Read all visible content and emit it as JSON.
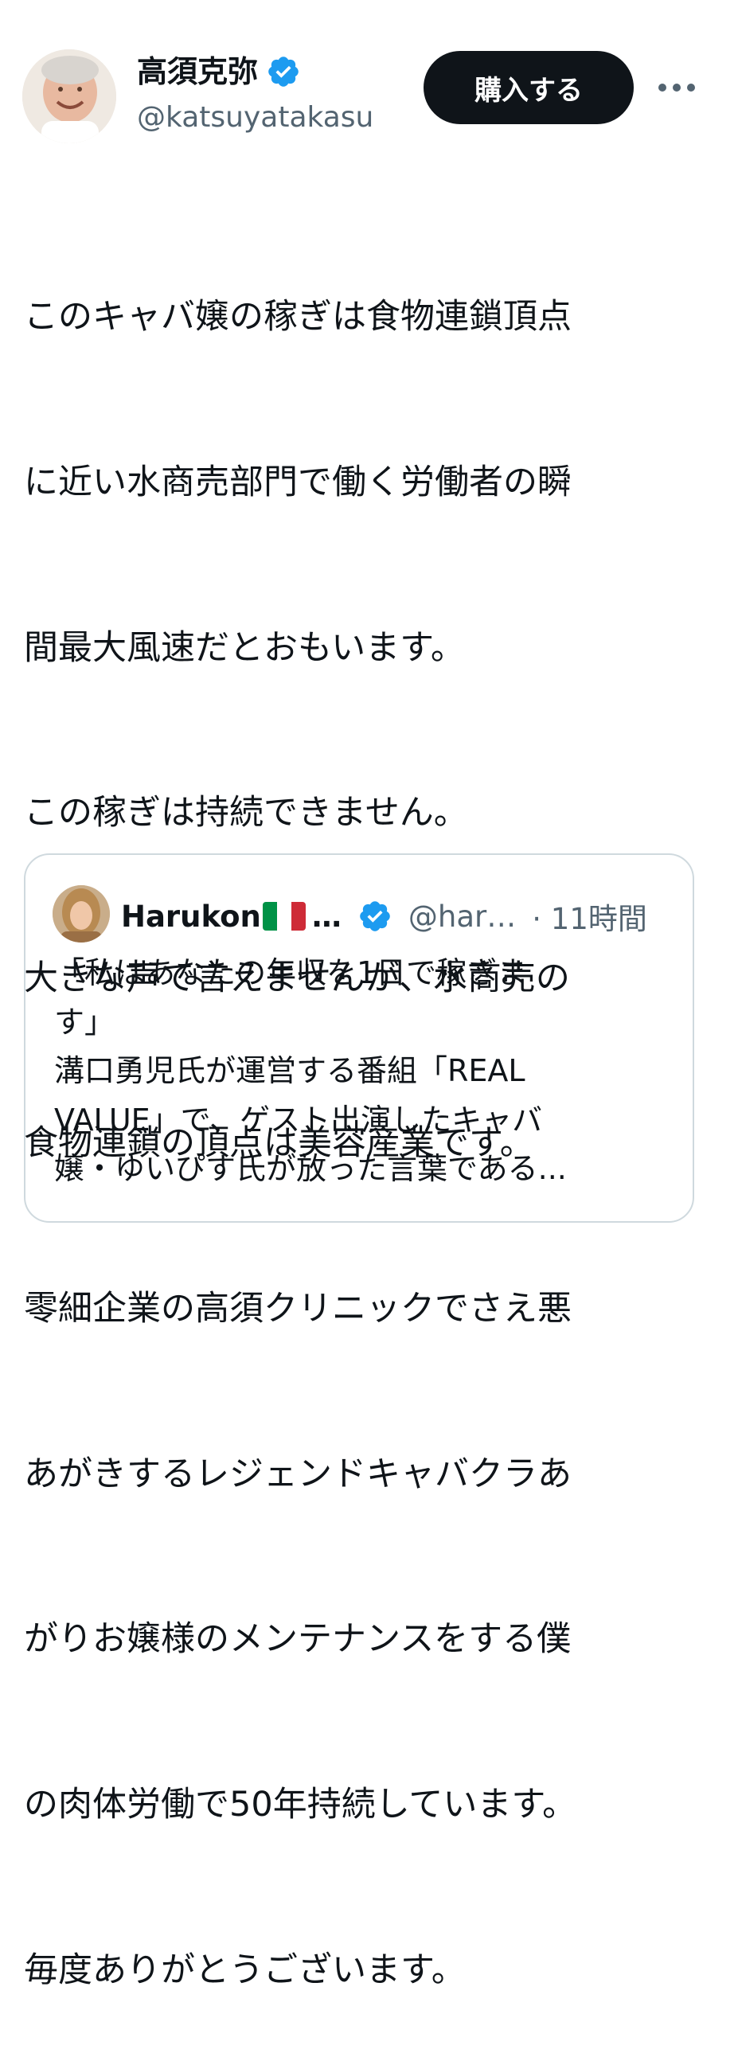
{
  "author": {
    "name": "高須克弥",
    "handle": "@katsuyatakasu",
    "verified_badge": "verified-check-icon",
    "badge_color": "#1d9bf0"
  },
  "actions": {
    "buy_label": "購入する",
    "more_icon": "more-horizontal-icon"
  },
  "tweet": {
    "lines": [
      "このキャバ嬢の稼ぎは食物連鎖頂点",
      "に近い水商売部門で働く労働者の瞬",
      "間最大風速だとおもいます。",
      "この稼ぎは持続できません。",
      "大きな声で言えませんが、水商売の",
      "食物連鎖の頂点は美容産業です。",
      "零細企業の高須クリニックでさえ悪",
      "あがきするレジェンドキャバクラあ",
      "がりお嬢様のメンテナンスをする僕",
      "の肉体労働で50年持続しています。",
      "毎度ありがとうございます。"
    ]
  },
  "quoted": {
    "name": "Harukon",
    "name_ellipsis": "…",
    "flag_icon": "italy-flag-icon",
    "handle": "@har…",
    "time": "· 11時間",
    "lines": [
      "「私はあなたの年収を1日で稼ぎま",
      "す」",
      "溝口勇児氏が運営する番組「REAL",
      "VALUE」で、ゲスト出演したキャバ",
      "嬢・ゆいぴす氏が放った言葉である..."
    ]
  },
  "colors": {
    "text": "#0f1419",
    "secondary": "#536471",
    "button_bg": "#0f1419",
    "border": "#cfd9de"
  }
}
